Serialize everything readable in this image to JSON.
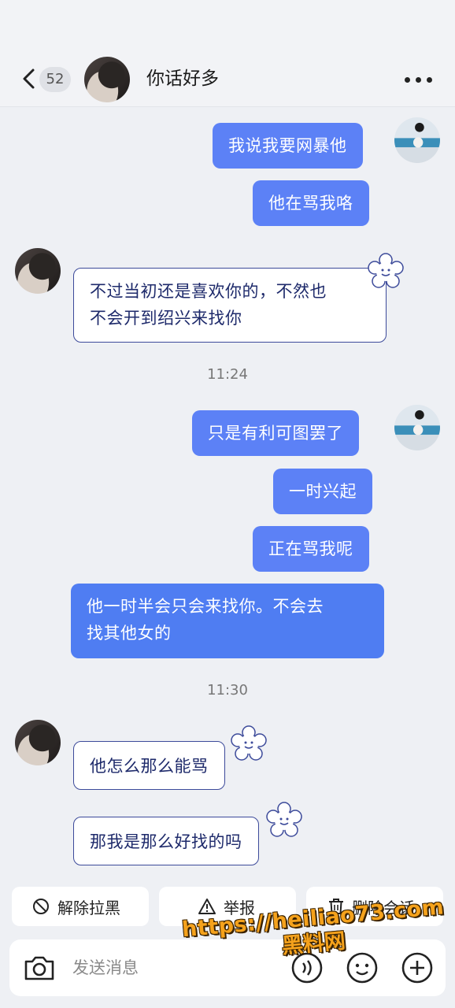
{
  "header": {
    "unread_count": "52",
    "title": "你话好多"
  },
  "messages": [
    {
      "side": "me",
      "text": "我说我要网暴他"
    },
    {
      "side": "me",
      "text": "他在骂我咯"
    },
    {
      "side": "peer",
      "line1": "不过当初还是喜欢你的，不然也",
      "line2": "不会开到绍兴来找你"
    },
    {
      "type": "time",
      "text": "11:24"
    },
    {
      "side": "me",
      "text": "只是有利可图罢了"
    },
    {
      "side": "me",
      "text": "一时兴起"
    },
    {
      "side": "me",
      "text": "正在骂我呢"
    },
    {
      "side": "me",
      "line1": "他一时半会只会来找你。不会去",
      "line2": "找其他女的"
    },
    {
      "type": "time",
      "text": "11:30"
    },
    {
      "side": "peer",
      "text": "他怎么那么能骂"
    },
    {
      "side": "peer",
      "text": "那我是那么好找的吗"
    }
  ],
  "actions": {
    "unblock": "解除拉黑",
    "report": "举报",
    "delete_chat": "删除会话"
  },
  "input": {
    "placeholder": "发送消息"
  },
  "watermark": {
    "url": "https://heiliao73.com",
    "name": "黑料网"
  },
  "icons": [
    "back-chevron-icon",
    "more-icon",
    "flower-sticker-icon",
    "block-icon",
    "warning-icon",
    "trash-icon",
    "camera-icon",
    "voice-icon",
    "emoji-icon",
    "plus-icon"
  ],
  "colors": {
    "my_bubble": "#5c81f6",
    "peer_bubble_border": "#3c4a9a",
    "background": "#eef0f4",
    "watermark": "#f5a21c"
  }
}
